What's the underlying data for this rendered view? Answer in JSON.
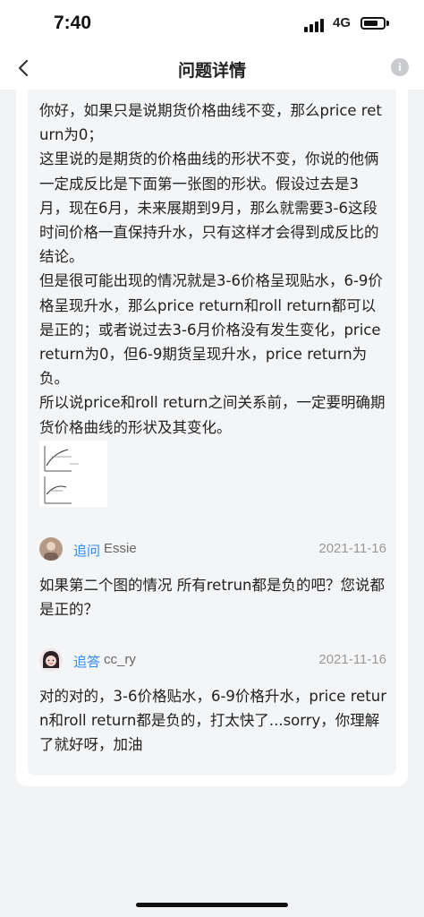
{
  "status_bar": {
    "time": "7:40",
    "network": "4G"
  },
  "nav": {
    "title": "问题详情",
    "back_icon": "chevron-left-icon",
    "info_icon": "info-icon",
    "info_glyph": "i"
  },
  "answer": {
    "paragraphs": [
      "你好，如果只是说期货价格曲线不变，那么price return为0；",
      "这里说的是期货的价格曲线的形状不变，你说的他俩一定成反比是下面第一张图的形状。假设过去是3月，现在6月，未来展期到9月，那么就需要3-6这段时间价格一直保持升水，只有这样才会得到成反比的结论。",
      "但是很可能出现的情况就是3-6价格呈现贴水，6-9价格呈现升水，那么price return和roll return都可以是正的；或者说过去3-6月价格没有发生变化，price return为0，但6-9期货呈现升水，price return为负。",
      "所以说price和roll return之间关系前，一定要明确期货价格曲线的形状及其变化。"
    ]
  },
  "replies": [
    {
      "type": "追问",
      "user": "Essie",
      "date": "2021-11-16",
      "body": "如果第二个图的情况 所有retrun都是负的吧？您说都是正的？"
    },
    {
      "type": "追答",
      "user": "cc_ry",
      "date": "2021-11-16",
      "body": "对的对的，3-6价格贴水，6-9价格升水，price return和roll return都是负的，打太快了...sorry，你理解了就好呀，加油"
    }
  ],
  "colors": {
    "accent": "#2f8cf0",
    "page_bg": "#f2f3f5",
    "inner_bg": "#f4f5f7"
  }
}
